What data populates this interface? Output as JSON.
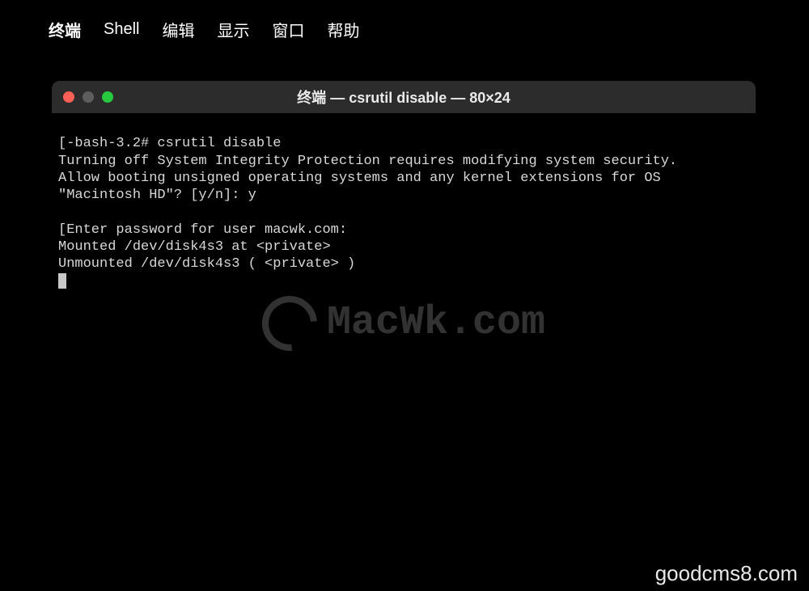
{
  "menubar": {
    "apple_icon": "",
    "items": [
      "终端",
      "Shell",
      "编辑",
      "显示",
      "窗口",
      "帮助"
    ]
  },
  "window": {
    "title": "终端 — csrutil disable — 80×24",
    "traffic": {
      "close": "close",
      "minimize": "minimize",
      "maximize": "maximize"
    }
  },
  "terminal": {
    "lines": [
      "[-bash-3.2# csrutil disable",
      "Turning off System Integrity Protection requires modifying system security.",
      "Allow booting unsigned operating systems and any kernel extensions for OS \"Macintosh HD\"? [y/n]: y",
      "",
      "[Enter password for user macwk.com:",
      "Mounted /dev/disk4s3 at <private>",
      "Unmounted /dev/disk4s3 ( <private> )"
    ]
  },
  "watermarks": {
    "center": "MacWk.com",
    "bottom": "goodcms8.com"
  }
}
